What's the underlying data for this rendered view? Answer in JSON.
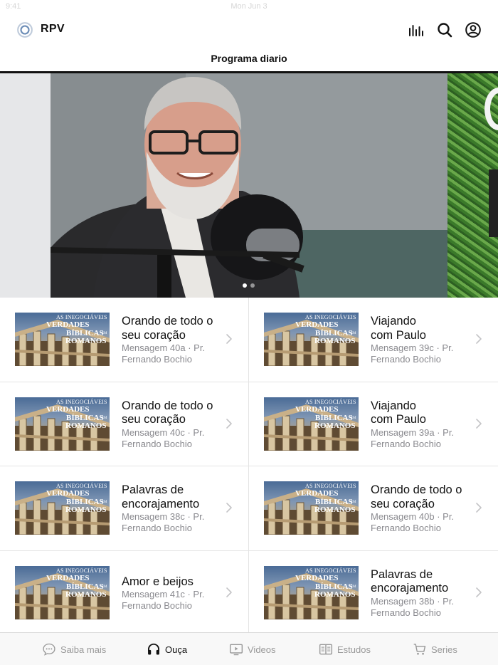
{
  "status_bar": {
    "time": "9:41",
    "date": "Mon Jun 3"
  },
  "app": {
    "title": "RPV"
  },
  "header_icons": [
    "equalizer-icon",
    "search-icon",
    "account-icon"
  ],
  "page_title": "Programa diario",
  "hero": {
    "slide_count": 2,
    "active_slide": 1
  },
  "items": [
    {
      "title_line1": "Orando de todo o",
      "title_line2": "seu coração",
      "sub_line1": "Mensagem 40a · Pr.",
      "sub_line2": "Fernando Bochio"
    },
    {
      "title_line1": "Viajando",
      "title_line2": "com Paulo",
      "sub_line1": "Mensagem 39c · Pr.",
      "sub_line2": "Fernando Bochio"
    },
    {
      "title_line1": "Orando de todo o",
      "title_line2": "seu coração",
      "sub_line1": "Mensagem 40c · Pr.",
      "sub_line2": "Fernando Bochio"
    },
    {
      "title_line1": "Viajando",
      "title_line2": "com Paulo",
      "sub_line1": "Mensagem 39a · Pr.",
      "sub_line2": "Fernando Bochio"
    },
    {
      "title_line1": "Palavras de",
      "title_line2": "encorajamento",
      "sub_line1": "Mensagem 38c · Pr.",
      "sub_line2": "Fernando Bochio"
    },
    {
      "title_line1": "Orando de todo o",
      "title_line2": "seu coração",
      "sub_line1": "Mensagem 40b · Pr.",
      "sub_line2": "Fernando Bochio"
    },
    {
      "title_line1": "Amor e beijos",
      "title_line2": "",
      "sub_line1": "Mensagem 41c · Pr.",
      "sub_line2": "Fernando Bochio"
    },
    {
      "title_line1": "Palavras de",
      "title_line2": "encorajamento",
      "sub_line1": "Mensagem 38b · Pr.",
      "sub_line2": "Fernando Bochio"
    }
  ],
  "thumbnail": {
    "line1": "AS INEGOCIÁVEIS",
    "line2": "VERDADES",
    "line3": "BÍBLICAS",
    "line3_small": "EM",
    "line4": "ROMANOS"
  },
  "tabs": [
    {
      "label": "Saiba mais",
      "icon": "chat-bubble-icon",
      "active": false
    },
    {
      "label": "Ouça",
      "icon": "headphones-icon",
      "active": true
    },
    {
      "label": "Videos",
      "icon": "play-screen-icon",
      "active": false
    },
    {
      "label": "Estudos",
      "icon": "book-icon",
      "active": false
    },
    {
      "label": "Series",
      "icon": "cart-icon",
      "active": false
    }
  ],
  "colors": {
    "accent": "#111111",
    "inactive_tab": "#999999",
    "secondary_text": "#8a8a8f"
  }
}
